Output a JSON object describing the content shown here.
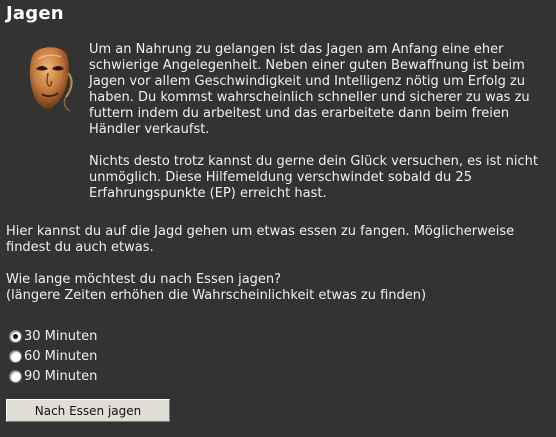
{
  "page": {
    "title": "Jagen"
  },
  "help": {
    "icon": "mask-icon",
    "paragraphs": [
      "Um an Nahrung zu gelangen ist das Jagen am Anfang eine eher schwierige Angelegenheit. Neben einer guten Bewaffnung ist beim Jagen vor allem Geschwindigkeit und Intelligenz nötig um Erfolg zu haben. Du kommst wahrscheinlich schneller und sicherer zu was zu futtern indem du arbeitest und das erarbeitete dann beim freien Händler verkaufst.",
      "Nichts desto trotz kannst du gerne dein Glück versuchen, es ist nicht unmöglich. Diese Hilfemeldung verschwindet sobald du 25 Erfahrungspunkte (EP) erreicht hast."
    ]
  },
  "intro": "Hier kannst du auf die Jagd gehen um etwas essen zu fangen. Möglicherweise findest du auch etwas.",
  "question": {
    "line1": "Wie lange möchtest du nach Essen jagen?",
    "line2": "(längere Zeiten erhöhen die Wahrscheinlichkeit etwas zu finden)"
  },
  "options": [
    {
      "label": "30 Minuten",
      "selected": true
    },
    {
      "label": "60 Minuten",
      "selected": false
    },
    {
      "label": "90 Minuten",
      "selected": false
    }
  ],
  "submit_label": "Nach Essen jagen",
  "colors": {
    "background": "#333333",
    "text": "#f0f0f0",
    "button": "#e0ddd6"
  }
}
